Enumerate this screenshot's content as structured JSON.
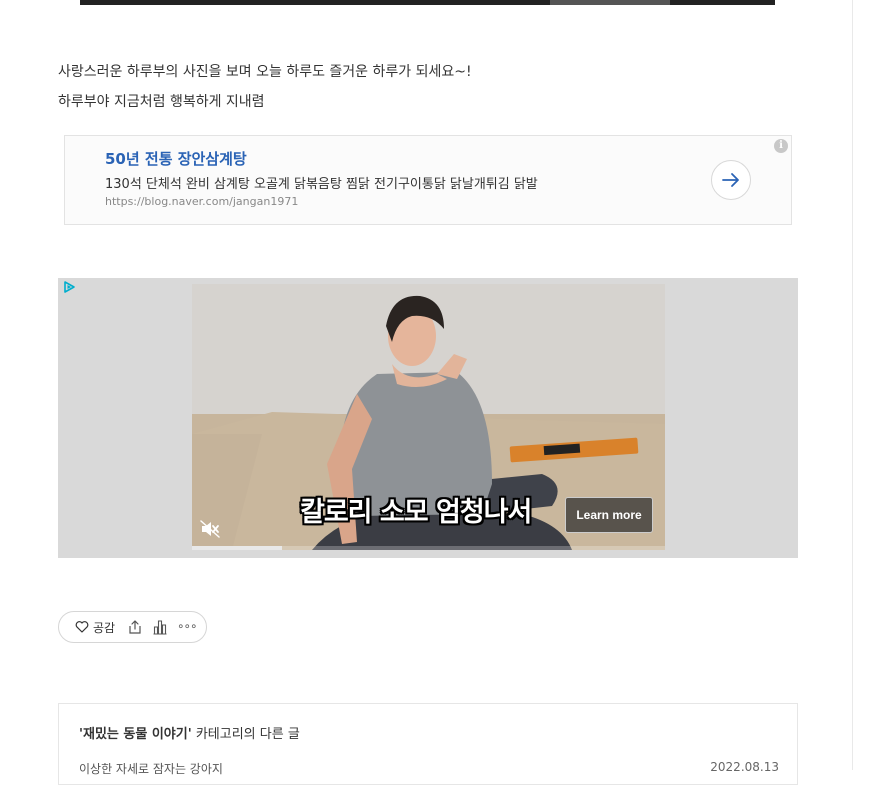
{
  "post": {
    "paragraph1": "사랑스러운 하루부의 사진을 보며 오늘 하루도 즐거운 하루가 되세요~!",
    "paragraph2": "하루부야 지금처럼 행복하게 지내렴"
  },
  "text_ad": {
    "title": "50년 전통 장안삼계탕",
    "description": "130석 단체석 완비 삼계탕 오골계 닭볶음탕 찜닭 전기구이통닭 닭날개튀김 닭발",
    "url": "https://blog.naver.com/jangan1971",
    "info_icon": "info-icon",
    "arrow_icon": "arrow-right-icon"
  },
  "video_ad": {
    "caption": "칼로리 소모 엄청나서",
    "cta_label": "Learn more",
    "mute_icon": "speaker-muted-icon",
    "progress": 0.19
  },
  "reactions": {
    "like_label": "공감",
    "icons": [
      "heart-icon",
      "share-icon",
      "stats-icon",
      "more-icon"
    ]
  },
  "related": {
    "category": "'재밌는 동물 이야기'",
    "title_suffix": " 카테고리의 다른 글",
    "items": [
      {
        "title": "이상한 자세로 잠자는 강아지",
        "date": "2022.08.13"
      }
    ]
  },
  "colors": {
    "accent_blue": "#2a63b5",
    "video_bg": "#d9d9d9"
  }
}
